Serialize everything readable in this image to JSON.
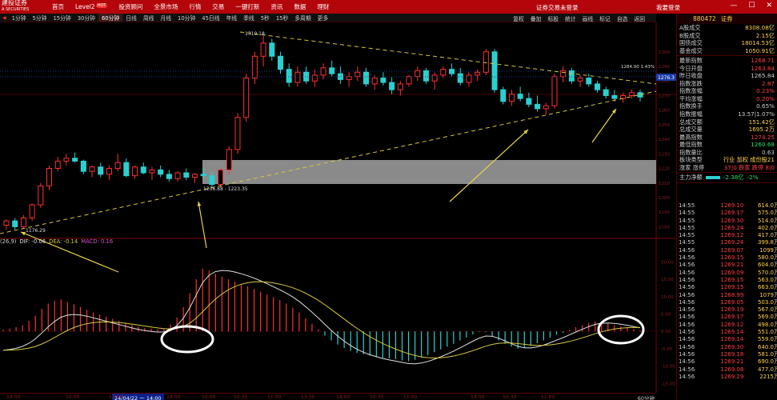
{
  "app": {
    "logo_line1": "建投证券",
    "logo_line2": "A SECURITIES",
    "menu": [
      "首页",
      "Level2",
      "投资顾问",
      "全景市场",
      "行情",
      "交易",
      "一键打新",
      "资讯",
      "数据",
      "理财"
    ],
    "level2_badge": "HOT",
    "login_status": "证券交易未登录",
    "login_link": "我要登录",
    "window_controls": [
      "—",
      "☐",
      "✕"
    ]
  },
  "period_bar": {
    "items": [
      "1分钟",
      "5分钟",
      "15分钟",
      "30分钟",
      "60分钟",
      "日线",
      "周线",
      "月线",
      "10分钟",
      "45日线",
      "年线",
      "季线",
      "5秒",
      "15秒",
      "多周期",
      "更多"
    ],
    "active": "60分钟",
    "tools": [
      "复权",
      "叠加",
      "标股",
      "统计",
      "画线",
      "标记",
      "自选",
      "返回"
    ]
  },
  "chart": {
    "price_labels": {
      "high": "1310.18",
      "mid": "1206.88 - 1223.35",
      "low": "1176.29",
      "ref_line": "1284.00 1.43%",
      "current": "1276.3"
    },
    "y_ticks": [
      "1300",
      "1290",
      "1280",
      "1270",
      "1260",
      "1250",
      "1240",
      "1230",
      "1220",
      "1210",
      "1200",
      "1190",
      "1180"
    ],
    "y_ticks_pct": [
      "2.46%",
      "1.67%",
      "0.88%",
      "0.10%",
      "0.69%",
      "1.48%",
      "2.27%",
      "3.06%"
    ],
    "macd_label": {
      "prefix": "(26,9)",
      "dif": "DIF: -0.06",
      "dea": "DEA: -0.14",
      "macd": "MACD: 0.16"
    },
    "macd_ticks": [
      "20.00",
      "15.00",
      "10.00",
      "5.00",
      "0.00",
      "-5.00",
      "-10.00",
      "-15.00"
    ],
    "x_ticks": [
      "14:00",
      "10:00",
      "11:00",
      "14:00",
      "10:00",
      "10:30",
      "11:00",
      "13:30",
      "14:00",
      "10:30",
      "11:00",
      "14:00",
      "10:30",
      "11:00"
    ],
    "cursor_time": "24/04/22 一 14:00",
    "period_tag": "60分钟"
  },
  "right_panel": {
    "code": "880472",
    "name": "证券",
    "volumes": [
      {
        "label": "A股成交",
        "value": "8308.08亿",
        "color": "#ffd24a"
      },
      {
        "label": "B股成交",
        "value": "2.15亿",
        "color": "#ffd24a"
      },
      {
        "label": "国债成交",
        "value": "18014.53亿",
        "color": "#ffd24a"
      },
      {
        "label": "基金成交",
        "value": "1050.91亿",
        "color": "#ffd24a"
      }
    ],
    "stats": [
      {
        "label": "最新指数",
        "value": "1268.71",
        "color": "#ff4040"
      },
      {
        "label": "今日开盘",
        "value": "1263.84",
        "color": "#ff4040"
      },
      {
        "label": "昨日收盘",
        "value": "1265.84",
        "color": "#ccc"
      },
      {
        "label": "指数涨跌",
        "value": "2.87",
        "color": "#ff4040"
      },
      {
        "label": "指数涨幅",
        "value": "0.23%",
        "color": "#ff4040"
      },
      {
        "label": "平均涨幅",
        "value": "0.20%",
        "color": "#ff4040"
      },
      {
        "label": "指数换手",
        "value": "0.65%",
        "color": "#ccc"
      },
      {
        "label": "指数振幅",
        "value": "13.57|1.07%",
        "color": "#ccc"
      },
      {
        "label": "总成交额",
        "value": "151.42亿",
        "color": "#ffd24a"
      },
      {
        "label": "总成交量",
        "value": "1695.2万",
        "color": "#ffd24a"
      },
      {
        "label": "最高指数",
        "value": "1274.25",
        "color": "#ff4040"
      },
      {
        "label": "最低指数",
        "value": "1260.68",
        "color": "#2adf6a"
      },
      {
        "label": "指数量比",
        "value": "0.63",
        "color": "#ccc"
      },
      {
        "label": "板块类型",
        "value": "行业 加权 成份股21",
        "color": "#ffd24a"
      },
      {
        "label": "涨家 涨停",
        "value": "37|0 跌家 跌停 8|0",
        "color": "#ff4040"
      }
    ],
    "flow": {
      "label": "主力净额",
      "value": "-2.38亿",
      "pct": "-2%"
    },
    "ticks": [
      [
        "14:55",
        "1269.10",
        "614.0",
        "万"
      ],
      [
        "14:55",
        "1269.17",
        "575.0",
        "万"
      ],
      [
        "14:55",
        "1269.30",
        "514.0",
        "万"
      ],
      [
        "14:55",
        "1269.24",
        "402.0",
        "万"
      ],
      [
        "14:55",
        "1269.12",
        "417.0",
        "万"
      ],
      [
        "14:55",
        "1269.24",
        "399.8",
        "万"
      ],
      [
        "14:56",
        "1269.07",
        "1099",
        "万"
      ],
      [
        "14:56",
        "1269.15",
        "580.0",
        "万"
      ],
      [
        "14:56",
        "1269.21",
        "604.0",
        "万"
      ],
      [
        "14:56",
        "1269.09",
        "570.0",
        "万"
      ],
      [
        "14:56",
        "1269.15",
        "563.0",
        "万"
      ],
      [
        "14:56",
        "1269.15",
        "663.0",
        "万"
      ],
      [
        "14:56",
        "1268.99",
        "1079",
        "万"
      ],
      [
        "14:56",
        "1269.05",
        "503.0",
        "万"
      ],
      [
        "14:56",
        "1269.19",
        "567.0",
        "万"
      ],
      [
        "14:56",
        "1269.17",
        "569.0",
        "万"
      ],
      [
        "14:56",
        "1269.12",
        "498.0",
        "万"
      ],
      [
        "14:56",
        "1269.14",
        "551.0",
        "万"
      ],
      [
        "14:56",
        "1269.14",
        "559.0",
        "万"
      ],
      [
        "14:56",
        "1269.30",
        "640.0",
        "万"
      ],
      [
        "14:56",
        "1269.18",
        "581.0",
        "万"
      ],
      [
        "14:56",
        "1269.21",
        "690.0",
        "万"
      ],
      [
        "14:56",
        "1269.08",
        "477.0",
        "万"
      ],
      [
        "14:56",
        "1269.29",
        "2215",
        "万"
      ]
    ]
  },
  "colors": {
    "up": "#ff3030",
    "down": "#2ad0d0",
    "trend": "#d6c83a",
    "arrow": "#e8d24a",
    "dif": "#e0e0e0",
    "dea": "#d6c83a",
    "shade": "#8a8a8a"
  },
  "chart_data": {
    "type": "line",
    "candles": [
      [
        1181,
        1185,
        1178,
        1184
      ],
      [
        1184,
        1186,
        1178,
        1180
      ],
      [
        1180,
        1188,
        1179,
        1186
      ],
      [
        1186,
        1196,
        1184,
        1195
      ],
      [
        1195,
        1210,
        1193,
        1208
      ],
      [
        1208,
        1222,
        1205,
        1220
      ],
      [
        1220,
        1228,
        1218,
        1225
      ],
      [
        1225,
        1230,
        1222,
        1227
      ],
      [
        1227,
        1231,
        1224,
        1225
      ],
      [
        1225,
        1226,
        1216,
        1218
      ],
      [
        1218,
        1222,
        1214,
        1221
      ],
      [
        1221,
        1224,
        1214,
        1216
      ],
      [
        1216,
        1222,
        1212,
        1220
      ],
      [
        1220,
        1230,
        1218,
        1224
      ],
      [
        1224,
        1227,
        1214,
        1215
      ],
      [
        1215,
        1222,
        1213,
        1221
      ],
      [
        1221,
        1224,
        1216,
        1217
      ],
      [
        1217,
        1221,
        1212,
        1219
      ],
      [
        1219,
        1222,
        1214,
        1216
      ],
      [
        1216,
        1219,
        1211,
        1213
      ],
      [
        1213,
        1218,
        1211,
        1217
      ],
      [
        1217,
        1220,
        1212,
        1214
      ],
      [
        1214,
        1217,
        1210,
        1216
      ],
      [
        1216,
        1220,
        1213,
        1215
      ],
      [
        1215,
        1218,
        1207,
        1209
      ],
      [
        1209,
        1220,
        1207,
        1219
      ],
      [
        1219,
        1235,
        1216,
        1233
      ],
      [
        1233,
        1258,
        1230,
        1255
      ],
      [
        1255,
        1285,
        1252,
        1282
      ],
      [
        1282,
        1300,
        1278,
        1297
      ],
      [
        1297,
        1311,
        1290,
        1306
      ],
      [
        1306,
        1309,
        1294,
        1297
      ],
      [
        1297,
        1300,
        1285,
        1288
      ],
      [
        1288,
        1292,
        1276,
        1279
      ],
      [
        1279,
        1290,
        1276,
        1286
      ],
      [
        1286,
        1290,
        1278,
        1280
      ],
      [
        1280,
        1288,
        1276,
        1284
      ],
      [
        1284,
        1292,
        1281,
        1289
      ],
      [
        1289,
        1294,
        1283,
        1285
      ],
      [
        1285,
        1290,
        1278,
        1281
      ],
      [
        1281,
        1286,
        1276,
        1283
      ],
      [
        1283,
        1290,
        1280,
        1286
      ],
      [
        1286,
        1289,
        1276,
        1278
      ],
      [
        1278,
        1284,
        1274,
        1282
      ],
      [
        1282,
        1286,
        1277,
        1279
      ],
      [
        1279,
        1283,
        1271,
        1274
      ],
      [
        1274,
        1280,
        1270,
        1278
      ],
      [
        1278,
        1284,
        1276,
        1283
      ],
      [
        1283,
        1290,
        1280,
        1287
      ],
      [
        1287,
        1289,
        1278,
        1280
      ],
      [
        1280,
        1286,
        1274,
        1284
      ],
      [
        1284,
        1290,
        1282,
        1288
      ],
      [
        1288,
        1292,
        1283,
        1285
      ],
      [
        1285,
        1289,
        1277,
        1279
      ],
      [
        1279,
        1286,
        1276,
        1284
      ],
      [
        1284,
        1288,
        1280,
        1286
      ],
      [
        1286,
        1302,
        1284,
        1300
      ],
      [
        1300,
        1302,
        1272,
        1274
      ],
      [
        1274,
        1276,
        1264,
        1266
      ],
      [
        1266,
        1274,
        1263,
        1271
      ],
      [
        1271,
        1276,
        1266,
        1268
      ],
      [
        1268,
        1272,
        1262,
        1264
      ],
      [
        1264,
        1270,
        1259,
        1261
      ],
      [
        1261,
        1265,
        1257,
        1263
      ],
      [
        1263,
        1285,
        1261,
        1283
      ],
      [
        1283,
        1290,
        1279,
        1287
      ],
      [
        1287,
        1289,
        1278,
        1280
      ],
      [
        1280,
        1284,
        1276,
        1282
      ],
      [
        1282,
        1285,
        1276,
        1278
      ],
      [
        1278,
        1280,
        1272,
        1274
      ],
      [
        1274,
        1276,
        1268,
        1270
      ],
      [
        1270,
        1274,
        1266,
        1268
      ],
      [
        1268,
        1272,
        1265,
        1270
      ],
      [
        1270,
        1274,
        1268,
        1272
      ],
      [
        1272,
        1274,
        1266,
        1269
      ]
    ],
    "ylim": [
      1172,
      1318
    ],
    "macd_hist": [
      0.5,
      0.8,
      1.2,
      1.8,
      3,
      4.5,
      6.5,
      8,
      8.8,
      9.2,
      8.5,
      7.8,
      7,
      6.2,
      5.4,
      4.8,
      4.2,
      3.6,
      3,
      2.4,
      1.8,
      1.4,
      1,
      0.8,
      0.6,
      0.8,
      2,
      4,
      7,
      11,
      15,
      18,
      17.5,
      16.6,
      15.8,
      15,
      14.3,
      13.6,
      13,
      12.2,
      11.4,
      10.6,
      9.8,
      9,
      8,
      6.8,
      5.4,
      3.8,
      2.2,
      0.6,
      -1.2,
      -2.6,
      -3.8,
      -4.8,
      -5.6,
      -6.2,
      -6.6,
      -7,
      -7.3,
      -7.6,
      -7.8,
      -8,
      -8.4,
      -8.6,
      -8.2,
      -7.6,
      -6.8,
      -6,
      -5.2,
      -4.4,
      -3.6,
      -2.6,
      -1.8,
      -0.9,
      -0.2,
      -0.2,
      -1.4,
      -2.6,
      -3.6,
      -4.4,
      -5,
      -4.8,
      -4.2,
      -3.4,
      -2.6,
      -1.8,
      -1.0,
      -0.4,
      0.4,
      1.2,
      1.8,
      2.4,
      2.8,
      2.6,
      2.2,
      1.8,
      1.4,
      1.0,
      0.6,
      0.3
    ],
    "macd_ylim": [
      -17,
      24
    ]
  }
}
